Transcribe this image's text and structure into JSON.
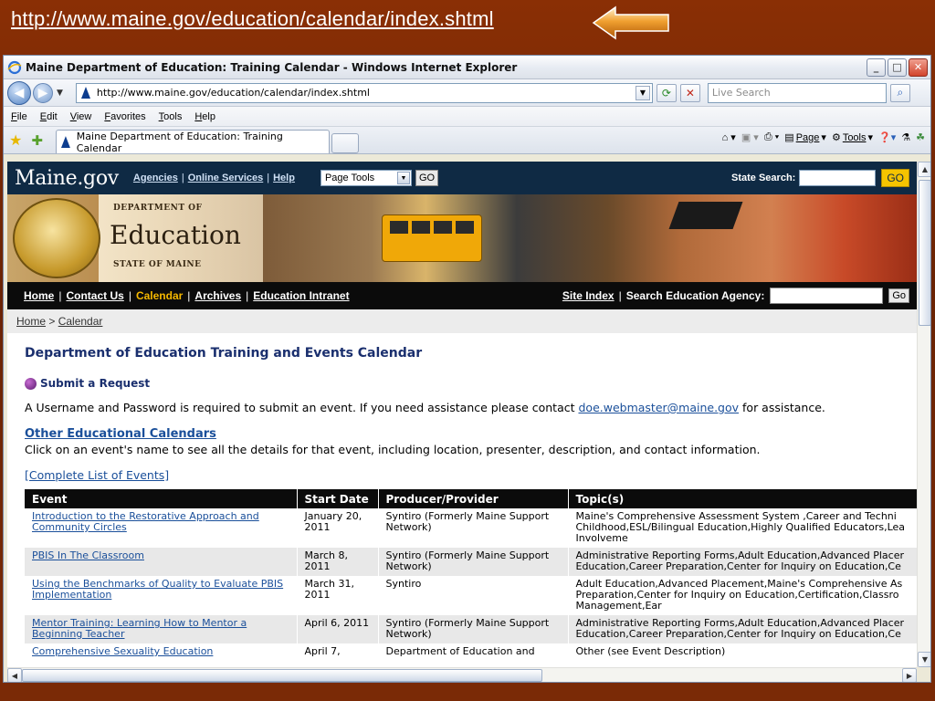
{
  "slide": {
    "url_text": "http://www.maine.gov/education/calendar/index.shtml"
  },
  "window": {
    "title": "Maine Department of Education: Training Calendar - Windows Internet Explorer",
    "controls": [
      "_",
      "□",
      "✕"
    ]
  },
  "address_bar": {
    "url": "http://www.maine.gov/education/calendar/index.shtml",
    "search_placeholder": "Live Search"
  },
  "menu": [
    "File",
    "Edit",
    "View",
    "Favorites",
    "Tools",
    "Help"
  ],
  "tab": {
    "label": "Maine Department of Education: Training Calendar"
  },
  "command_bar": {
    "page_label": "Page",
    "tools_label": "Tools"
  },
  "site": {
    "logo": "Maine.gov",
    "links": [
      "Agencies",
      "Online Services",
      "Help"
    ],
    "page_tools_select": "Page Tools",
    "go_label": "GO",
    "state_search_label": "State Search:",
    "state_go_label": "GO",
    "banner": {
      "dept_of": "DEPARTMENT OF",
      "education": "Education",
      "state_of": "STATE OF MAINE"
    },
    "nav": [
      "Home",
      "Contact Us",
      "Calendar",
      "Archives",
      "Education Intranet"
    ],
    "site_index": "Site Index",
    "search_agency_label": "Search Education Agency:",
    "search_go": "Go"
  },
  "breadcrumb": {
    "home": "Home",
    "sep": " > ",
    "current": "Calendar"
  },
  "content": {
    "title": "Department of Education Training and Events Calendar",
    "submit_request": "Submit a Request",
    "login_text": "A Username and Password is required to submit an event. If you need assistance please contact ",
    "email": "doe.webmaster@maine.gov",
    "login_text_end": " for assistance.",
    "other_calendars": "Other Educational Calendars",
    "click_text": "Click on an event's name to see all the details for that event, including location, presenter, description, and contact information.",
    "complete_list": "[Complete List of Events]"
  },
  "table": {
    "headers": [
      "Event",
      "Start Date",
      "Producer/Provider",
      "Topic(s)"
    ],
    "rows": [
      {
        "event": "Introduction to the Restorative Approach and Community Circles",
        "date": "January 20, 2011",
        "provider": "Syntiro (Formerly Maine Support Network)",
        "topic_lines": [
          "Maine's Comprehensive Assessment System ,Career and Techni",
          "Childhood,ESL/Bilingual Education,Highly Qualified Educators,Lea",
          "Involveme"
        ]
      },
      {
        "event": "PBIS In The Classroom",
        "date": "March 8, 2011",
        "provider": "Syntiro (Formerly Maine Support Network)",
        "topic_lines": [
          "Administrative Reporting Forms,Adult Education,Advanced Placer",
          "Education,Career Preparation,Center for Inquiry on Education,Ce"
        ]
      },
      {
        "event": "Using the Benchmarks of Quality to Evaluate PBIS Implementation",
        "date": "March 31, 2011",
        "provider": "Syntiro",
        "topic_lines": [
          "Adult Education,Advanced Placement,Maine's Comprehensive As",
          "Preparation,Center for Inquiry on Education,Certification,Classro",
          "Management,Ear"
        ]
      },
      {
        "event": "Mentor Training: Learning How to Mentor a Beginning Teacher",
        "date": "April 6, 2011",
        "provider": "Syntiro (Formerly Maine Support Network)",
        "topic_lines": [
          "Administrative Reporting Forms,Adult Education,Advanced Placer",
          "Education,Career Preparation,Center for Inquiry on Education,Ce"
        ]
      },
      {
        "event": "Comprehensive Sexuality Education",
        "date": "April 7,",
        "provider": "Department of Education and",
        "topic_lines": [
          "Other (see Event Description)"
        ]
      }
    ]
  }
}
